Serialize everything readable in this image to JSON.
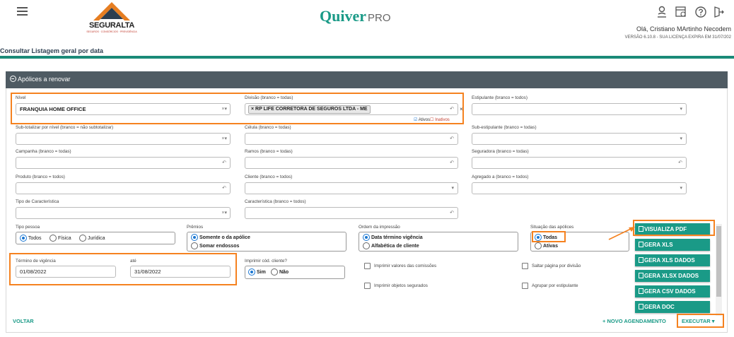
{
  "header": {
    "logo_text": "SEGURALTA",
    "logo_tagline": "SEGUROS · CONSÓRCIOS · PREVIDÊNCIA",
    "brand": "Quiver",
    "brand_suffix": "PRO",
    "greeting": "Olá, Cristiano MArtinho Necodem",
    "version": "VERSÃO 6.10.8 - SUA LICENÇA EXPIRA EM 31/07/202",
    "icons": [
      "user-icon",
      "calendar-icon",
      "help-icon",
      "logout-icon"
    ]
  },
  "page_title": "Consultar Listagem geral por data",
  "panel_title": "Apólices a renovar",
  "filters": {
    "nivel": {
      "label": "Nível",
      "value": "FRANQUIA HOME OFFICE"
    },
    "divisao": {
      "label": "Divisão (branco = todas)",
      "tag": "RP LIFE CORRETORA DE SEGUROS LTDA - ME",
      "ativos": "Ativos",
      "inativos": "Inativos"
    },
    "estipulante": {
      "label": "Estipulante (branco = todos)"
    },
    "subtotalizar": {
      "label": "Sub-totalizar por nível (branco = não subtotalizar)"
    },
    "celula": {
      "label": "Célula (branco = todas)"
    },
    "subestipulante": {
      "label": "Sub-estipulante (branco = todas)"
    },
    "campanha": {
      "label": "Campanha (branco = todas)"
    },
    "ramos": {
      "label": "Ramos (branco = todas)"
    },
    "seguradora": {
      "label": "Seguradora (branco = todas)"
    },
    "produto": {
      "label": "Produto (branco = todos)"
    },
    "cliente": {
      "label": "Cliente (branco = todos)"
    },
    "agregado": {
      "label": "Agregado a (branco = todos)"
    },
    "tipo_caracteristica": {
      "label": "Tipo de Característica"
    },
    "caracteristica": {
      "label": "Característica (branco = todos)"
    }
  },
  "tipo_pessoa": {
    "label": "Tipo pessoa",
    "options": [
      "Todos",
      "Física",
      "Jurídica"
    ],
    "selected": "Todos"
  },
  "premios": {
    "label": "Prêmios",
    "options": [
      "Somente o da apólice",
      "Somar endossos"
    ],
    "selected": "Somente o da apólice"
  },
  "ordem": {
    "label": "Ordem da impressão",
    "options": [
      "Data término vigência",
      "Alfabética de cliente"
    ],
    "selected": "Data término vigência"
  },
  "situacao": {
    "label": "Situação das apólices",
    "options": [
      "Todas",
      "Ativas"
    ],
    "selected": "Todas"
  },
  "termino": {
    "label": "Término de vigência",
    "from": "01/08/2022",
    "to_label": "até",
    "to": "31/08/2022"
  },
  "imprimir_cod": {
    "label": "Imprimir cód. cliente?",
    "options": [
      "Sim",
      "Não"
    ],
    "selected": "Sim"
  },
  "checkboxes": {
    "valores_comissoes": "Imprimir valores das comissões",
    "objetos_segurados": "Imprimir objetos segurados",
    "saltar_pagina": "Saltar página por divisão",
    "agrupar": "Agrupar por estipulante"
  },
  "export_menu": [
    "VISUALIZA PDF",
    "GERA XLS",
    "GERA XLS DADOS",
    "GERA XLSX DADOS",
    "GERA CSV DADOS",
    "GERA DOC"
  ],
  "actions": {
    "voltar": "VOLTAR",
    "novo_agendamento": "+ NOVO AGENDAMENTO",
    "executar": "EXECUTAR"
  },
  "accent_color": "#f58220",
  "brand_color": "#1a9a87"
}
